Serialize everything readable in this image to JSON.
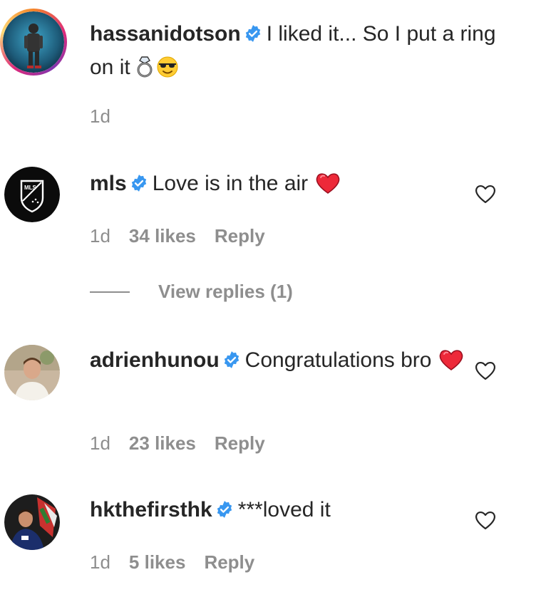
{
  "comments": [
    {
      "username": "hassanidotson",
      "text": "I liked it... So I put a ring on it",
      "time": "1d",
      "likes": "",
      "reply": "",
      "emojis": [
        "ring-icon",
        "sunglasses-face-icon"
      ]
    },
    {
      "username": "mls",
      "text": "Love is in the air",
      "time": "1d",
      "likes": "34 likes",
      "reply": "Reply",
      "emojis": [
        "red-heart-icon"
      ]
    },
    {
      "username": "adrienhunou",
      "text": "Congratulations bro",
      "time": "1d",
      "likes": "23 likes",
      "reply": "Reply",
      "emojis": [
        "red-heart-icon"
      ]
    },
    {
      "username": "hkthefirsthk",
      "text": "***loved it",
      "time": "1d",
      "likes": "5 likes",
      "reply": "Reply",
      "emojis": []
    }
  ],
  "view_replies": "View replies (1)",
  "colors": {
    "text": "#262626",
    "muted": "#8e8e8e",
    "verified": "#3897f0",
    "heart": "#ed2939"
  }
}
